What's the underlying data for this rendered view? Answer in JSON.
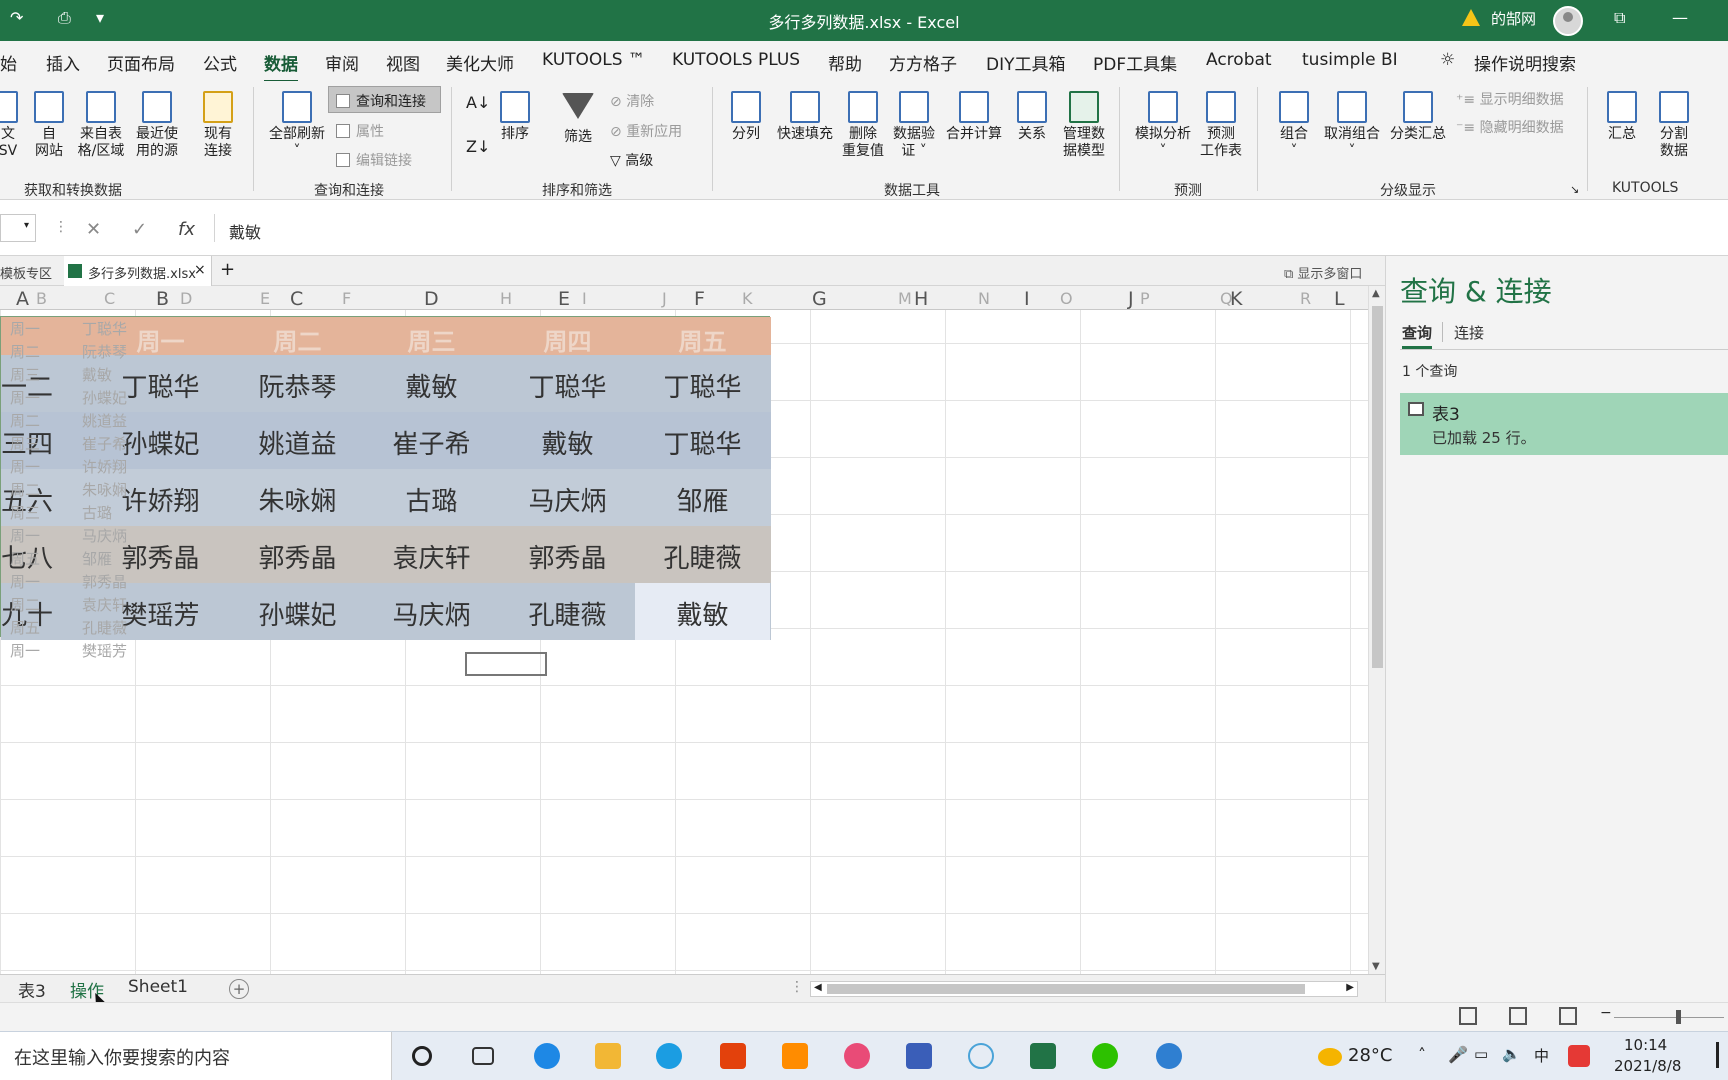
{
  "window": {
    "title": "多行多列数据.xlsx  -  Excel",
    "user": "的郜网"
  },
  "menu": [
    "始",
    "插入",
    "页面布局",
    "公式",
    "数据",
    "审阅",
    "视图",
    "美化大师",
    "KUTOOLS ™",
    "KUTOOLS PLUS",
    "帮助",
    "方方格子",
    "DIY工具箱",
    "PDF工具集",
    "Acrobat",
    "tusimple BI"
  ],
  "menu_active": "数据",
  "tell_me": "操作说明搜索",
  "ribbon": {
    "get": {
      "csv": "文\nSV",
      "web": "自\n网站",
      "table": "来自表\n格/区域",
      "recent": "最近使\n用的源",
      "existing": "现有\n连接",
      "group": "获取和转换数据"
    },
    "query": {
      "refresh": "全部刷新",
      "qc": "查询和连接",
      "props": "属性",
      "edit": "编辑链接",
      "group": "查询和连接"
    },
    "sort": {
      "sort": "排序",
      "filter": "筛选",
      "clear": "清除",
      "reapply": "重新应用",
      "adv": "高级",
      "group": "排序和筛选"
    },
    "tools": {
      "split": "分列",
      "flash": "快速填充",
      "dedup": "删除\n重复值",
      "valid": "数据验\n证 ˅",
      "consol": "合并计算",
      "rel": "关系",
      "model": "管理数\n据模型",
      "group": "数据工具"
    },
    "forecast": {
      "whatif": "模拟分析\n˅",
      "sheet": "预测\n工作表",
      "group": "预测"
    },
    "outline": {
      "grp": "组合\n˅",
      "ungrp": "取消组合\n˅",
      "subtotal": "分类汇总",
      "show": "显示明细数据",
      "hide": "隐藏明细数据",
      "group": "分级显示"
    },
    "kutools": {
      "sum": "汇总",
      "splitdata": "分割\n数据",
      "group": "KUTOOLS"
    }
  },
  "formula": {
    "cancel": "✕",
    "enter": "✓",
    "fx": "fx",
    "value": "戴敏"
  },
  "workbook_tabs": {
    "templates": "模板专区",
    "file": "多行多列数据.xlsx",
    "multi": "显示多窗口"
  },
  "columns": [
    "A",
    "B",
    "C",
    "D",
    "E",
    "F",
    "G",
    "H",
    "I",
    "J",
    "K",
    "L"
  ],
  "columns_light": [
    "B",
    "C",
    "D",
    "E",
    "F",
    "H",
    "I",
    "J",
    "K",
    "M",
    "N",
    "O",
    "P",
    "Q",
    "R"
  ],
  "ghost_rows": [
    [
      "周一",
      "丁聪华"
    ],
    [
      "周二",
      "阮恭琴"
    ],
    [
      "周三",
      "戴敏"
    ],
    [
      "周一",
      "孙蝶妃"
    ],
    [
      "周二",
      "姚道益"
    ],
    [
      "周三",
      "崔子希"
    ],
    [
      "周一",
      "许娇翔"
    ],
    [
      "周二",
      "朱咏娴"
    ],
    [
      "周三",
      "古璐"
    ],
    [
      "周一",
      "马庆炳"
    ],
    [
      "周五",
      "邹雁"
    ],
    [
      "周一",
      "郭秀晶"
    ],
    [
      "周二",
      "袁庆轩"
    ],
    [
      "周五",
      "孔睫薇"
    ],
    [
      "周一",
      "樊瑶芳"
    ]
  ],
  "table": {
    "headers": [
      "周一",
      "周二",
      "周三",
      "周四",
      "周五"
    ],
    "row_labels": [
      "一二",
      "三四",
      "五六",
      "七八",
      "九十"
    ],
    "rows": [
      [
        "丁聪华",
        "阮恭琴",
        "戴敏",
        "丁聪华",
        "丁聪华"
      ],
      [
        "孙蝶妃",
        "姚道益",
        "崔子希",
        "戴敏",
        "丁聪华"
      ],
      [
        "许娇翔",
        "朱咏娴",
        "古璐",
        "马庆炳",
        "邹雁"
      ],
      [
        "郭秀晶",
        "郭秀晶",
        "袁庆轩",
        "郭秀晶",
        "孔睫薇"
      ],
      [
        "樊瑶芳",
        "孙蝶妃",
        "马庆炳",
        "孔睫薇",
        "戴敏"
      ]
    ]
  },
  "sheets": [
    "表3",
    "操作",
    "Sheet1"
  ],
  "sheet_active": "操作",
  "pane": {
    "title": "查询 & 连接",
    "tabs": [
      "查询",
      "连接"
    ],
    "count": "1 个查询",
    "query_name": "表3",
    "query_status": "已加载 25 行。"
  },
  "taskbar": {
    "search": "在这里输入你要搜索的内容",
    "weather": "28°C",
    "time": "10:14",
    "date": "2021/8/8",
    "ime": "中"
  },
  "colors": {
    "excel_green": "#217346",
    "header_band": "#e4b49a",
    "row_band": "#bcc7d4"
  }
}
